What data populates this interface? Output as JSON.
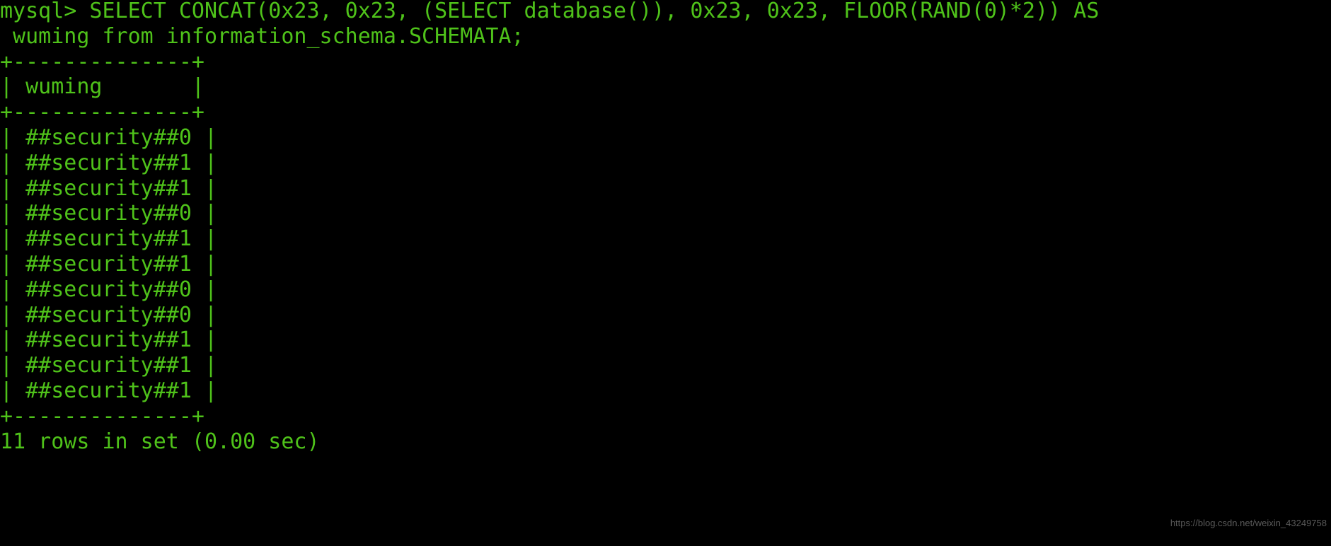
{
  "terminal": {
    "title": "mysql-console",
    "colors": {
      "background": "#000000",
      "foreground": "#4fc21a",
      "watermark": "#5a5a5a"
    },
    "prompt": "mysql>",
    "lines": [
      "mysql> SELECT CONCAT(0x23, 0x23, (SELECT database()), 0x23, 0x23, FLOOR(RAND(0)*2)) AS",
      " wuming from information_schema.SCHEMATA;",
      "+--------------+",
      "| wuming       |",
      "+--------------+",
      "| ##security##0 |",
      "| ##security##1 |",
      "| ##security##1 |",
      "| ##security##0 |",
      "| ##security##1 |",
      "| ##security##1 |",
      "| ##security##0 |",
      "| ##security##0 |",
      "| ##security##1 |",
      "| ##security##1 |",
      "| ##security##1 |",
      "+--------------+",
      "11 rows in set (0.00 sec)"
    ],
    "query": {
      "statement": "SELECT CONCAT(0x23, 0x23, (SELECT database()), 0x23, 0x23, FLOOR(RAND(0)*2)) AS wuming from information_schema.SCHEMATA;",
      "alias": "wuming",
      "source_table": "information_schema.SCHEMATA"
    },
    "result_table": {
      "column_header": "wuming",
      "border": "+--------------+",
      "rows": [
        "##security##0",
        "##security##1",
        "##security##1",
        "##security##0",
        "##security##1",
        "##security##1",
        "##security##0",
        "##security##0",
        "##security##1",
        "##security##1",
        "##security##1"
      ],
      "row_count": 11,
      "status": "11 rows in set (0.00 sec)"
    },
    "watermark": "https://blog.csdn.net/weixin_43249758"
  }
}
